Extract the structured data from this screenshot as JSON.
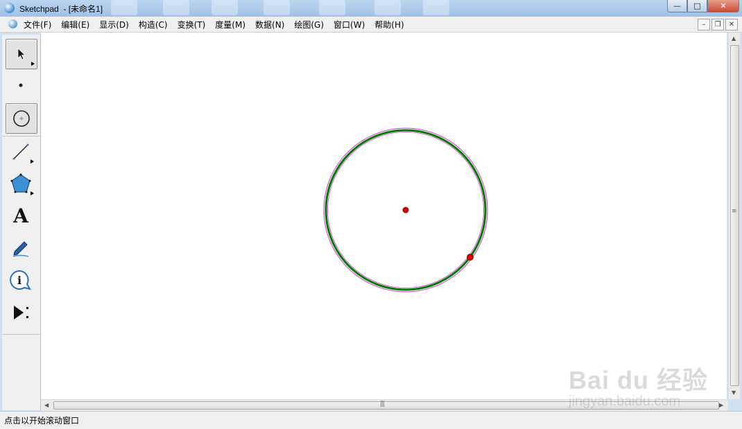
{
  "window": {
    "title": "Sketchpad  - [未命名1]",
    "minimize_glyph": "—",
    "maximize_glyph": "□",
    "close_glyph": "✕"
  },
  "menu": {
    "items": [
      "文件(F)",
      "编辑(E)",
      "显示(D)",
      "构造(C)",
      "变换(T)",
      "度量(M)",
      "数据(N)",
      "绘图(G)",
      "窗口(W)",
      "帮助(H)"
    ],
    "mdi_minimize": "–",
    "mdi_restore": "❐",
    "mdi_close": "✕"
  },
  "toolbox": {
    "tools": [
      {
        "name": "selection-arrow-tool",
        "icon": "arrow-cursor-icon",
        "has_submenu": true
      },
      {
        "name": "point-tool",
        "icon": "point-icon"
      },
      {
        "name": "compass-tool",
        "icon": "circle-icon",
        "active": true
      },
      {
        "name": "straightedge-tool",
        "icon": "line-segment-icon",
        "has_submenu": true
      },
      {
        "name": "polygon-tool",
        "icon": "pentagon-icon",
        "has_submenu": true
      },
      {
        "name": "text-tool",
        "icon": "letter-a-icon",
        "glyph": "A"
      },
      {
        "name": "marker-tool",
        "icon": "pen-icon"
      },
      {
        "name": "information-tool",
        "icon": "info-icon"
      },
      {
        "name": "custom-tool",
        "icon": "play-more-icon"
      }
    ]
  },
  "canvas": {
    "circle": {
      "center_point_color": "#e00000",
      "radius_point_color": "#e00000",
      "stroke_color": "#007a00",
      "highlight_color": "#cc33cc"
    }
  },
  "statusbar": {
    "text": "点击以开始滚动窗口"
  },
  "watermark": {
    "logo": "Bai du 经验",
    "url": "jingyan.baidu.com"
  }
}
